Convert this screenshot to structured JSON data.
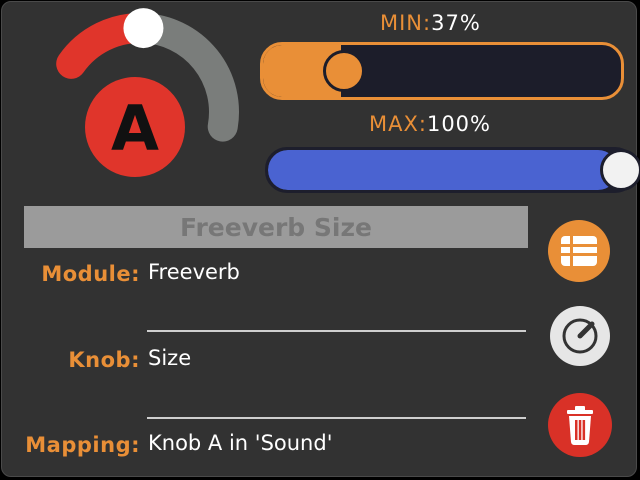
{
  "knob": {
    "letter": "A",
    "level": 0.37,
    "colors": {
      "active": "#e0352b",
      "inactive": "#7a7d7b",
      "thumb": "#ffffff",
      "badge": "#e0352b",
      "letter": "#111111"
    }
  },
  "min_slider": {
    "label": "MIN:",
    "value_text": "37%",
    "value": 0.37
  },
  "max_slider": {
    "label": "MAX:",
    "value_text": "100%",
    "value": 1.0
  },
  "title": "Freeverb Size",
  "fields": {
    "module": {
      "label": "Module:",
      "value": "Freeverb"
    },
    "knob": {
      "label": "Knob:",
      "value": "Size"
    },
    "mapping": {
      "label": "Mapping:",
      "value": "Knob A in 'Sound'"
    }
  },
  "buttons": {
    "list": {
      "icon": "list-icon",
      "color": "#e98f37"
    },
    "knob": {
      "icon": "knob-icon",
      "color": "#e6e6e6"
    },
    "delete": {
      "icon": "trash-icon",
      "color": "#d93127"
    }
  },
  "colors": {
    "accent": "#e98f37",
    "panel": "#323232",
    "max_fill": "#4a63d1"
  }
}
